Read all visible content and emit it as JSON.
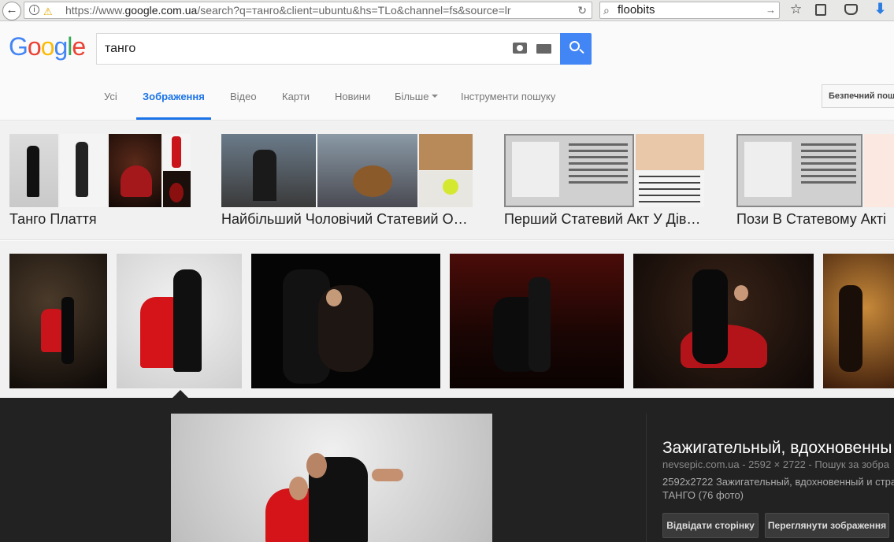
{
  "browser": {
    "url_prefix": "https://www.",
    "url_domain": "google.com.ua",
    "url_rest": "/search?q=танго&client=ubuntu&hs=TLo&channel=fs&source=lr",
    "search_text": "floobits"
  },
  "google": {
    "query": "танго",
    "logo_letters": [
      "G",
      "o",
      "o",
      "g",
      "l",
      "e"
    ]
  },
  "nav": {
    "items": [
      "Усі",
      "Зображення",
      "Відео",
      "Карти",
      "Новини",
      "Більше",
      "Інструменти пошуку"
    ],
    "active_index": 1,
    "safe_search": "Безпечний пош"
  },
  "related": [
    {
      "title": "Танго Плаття"
    },
    {
      "title": "Найбільший Чоловічий Статевий О…"
    },
    {
      "title": "Перший Статевий Акт У Дів…"
    },
    {
      "title": "Пози В Статевому Акті"
    }
  ],
  "preview": {
    "title": "Зажигательный, вдохновенны",
    "source": "nevsepic.com.ua",
    "dims": "2592 × 2722",
    "search_link": "Пошук за зобра",
    "desc_line1": "2592x2722 Зажигательный, вдохновенный и стра",
    "desc_line2": "ТАНГО (76 фото)",
    "visit_button": "Відвідати сторінку",
    "view_button": "Переглянути зображення"
  },
  "colors": {
    "google_blue": "#4285f4",
    "google_red": "#ea4335",
    "google_yellow": "#fbbc05",
    "google_green": "#34a853",
    "active_tab": "#1a73e8"
  }
}
